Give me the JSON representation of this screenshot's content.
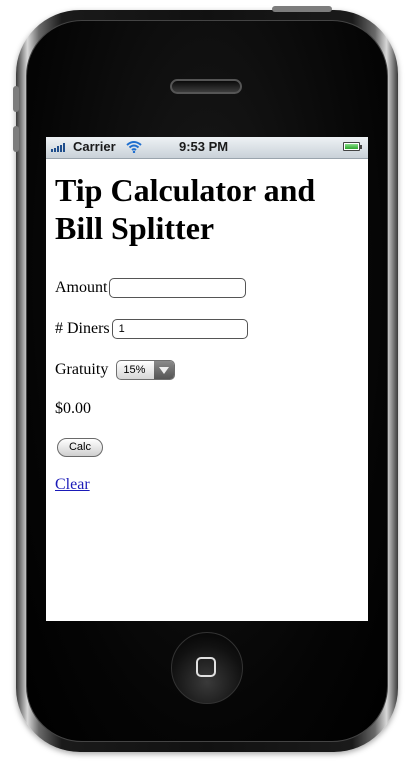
{
  "status_bar": {
    "carrier": "Carrier",
    "time": "9:53 PM",
    "signal_icon": "signal-bars-icon",
    "wifi_icon": "wifi-icon",
    "battery_icon": "battery-icon",
    "battery_level": 1.0
  },
  "page": {
    "title_line1": "Tip Calculator and",
    "title_line2": "Bill Splitter"
  },
  "form": {
    "amount_label": "Amount",
    "amount_value": "",
    "diners_label": "# Diners",
    "diners_value": "1",
    "gratuity_label": "Gratuity",
    "gratuity_selected": "15%",
    "total": "$0.00",
    "calc_label": "Calc",
    "clear_label": "Clear"
  },
  "colors": {
    "link": "#1a1ab8",
    "battery": "#2aa52a",
    "signal": "#1f4e8c"
  }
}
